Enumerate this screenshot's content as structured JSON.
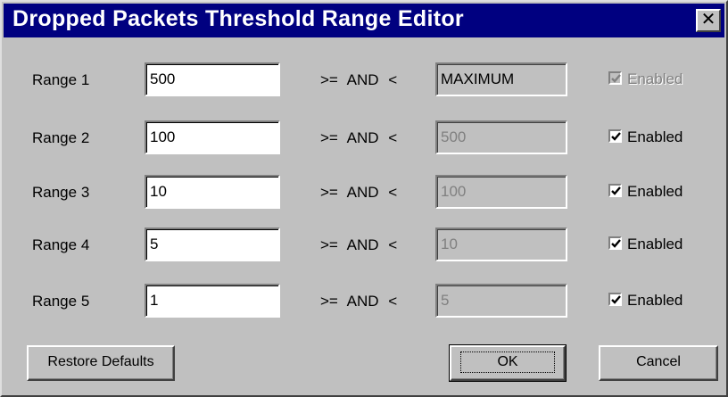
{
  "window": {
    "title": "Dropped Packets Threshold Range Editor",
    "close_symbol": "✕"
  },
  "operator_text": ">=  AND  <",
  "ranges": [
    {
      "label": "Range 1",
      "from": "500",
      "to": "MAXIMUM",
      "enabled_label": "Enabled",
      "enabled": true,
      "checkbox_disabled": true
    },
    {
      "label": "Range 2",
      "from": "100",
      "to": "500",
      "enabled_label": "Enabled",
      "enabled": true,
      "checkbox_disabled": false
    },
    {
      "label": "Range 3",
      "from": "10",
      "to": "100",
      "enabled_label": "Enabled",
      "enabled": true,
      "checkbox_disabled": false
    },
    {
      "label": "Range 4",
      "from": "5",
      "to": "10",
      "enabled_label": "Enabled",
      "enabled": true,
      "checkbox_disabled": false
    },
    {
      "label": "Range 5",
      "from": "1",
      "to": "5",
      "enabled_label": "Enabled",
      "enabled": true,
      "checkbox_disabled": false
    }
  ],
  "buttons": {
    "restore_defaults": "Restore Defaults",
    "ok": "OK",
    "cancel": "Cancel"
  },
  "colors": {
    "titlebar": "#000080",
    "face": "#c0c0c0",
    "disabled_text": "#808080"
  }
}
